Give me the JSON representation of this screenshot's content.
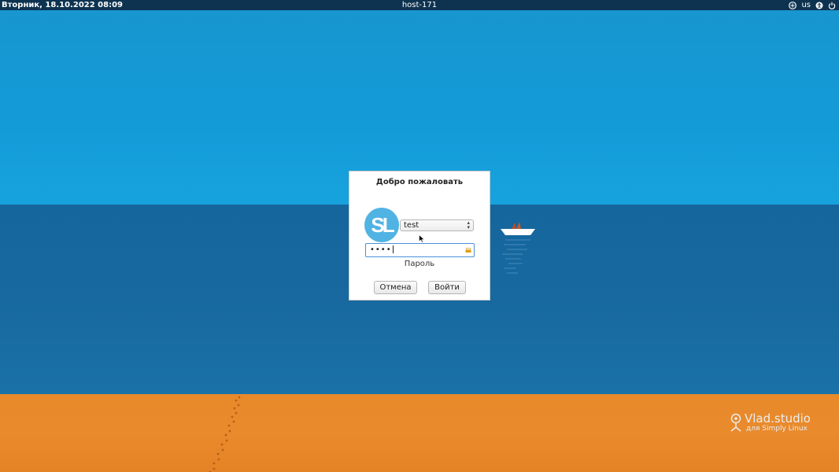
{
  "topbar": {
    "datetime": "Вторник, 18.10.2022 08:09",
    "hostname": "host-171",
    "layout": "us",
    "icons": [
      "network-icon",
      "accessibility-icon",
      "power-icon"
    ]
  },
  "dialog": {
    "title": "Добро пожаловать",
    "avatar_text": "SL",
    "user_value": "test",
    "password_masked": "••••",
    "password_label": "Пароль",
    "cancel_label": "Отмена",
    "login_label": "Войти"
  },
  "watermark": {
    "title": "Vlad.studio",
    "subtitle": "для Simply Linux"
  },
  "colors": {
    "topbar_bg": "#0d3350",
    "sky": "#139bd8",
    "sea": "#17699f",
    "sand": "#e98a2c",
    "avatar": "#50b3e3",
    "focus": "#4a90d9"
  }
}
